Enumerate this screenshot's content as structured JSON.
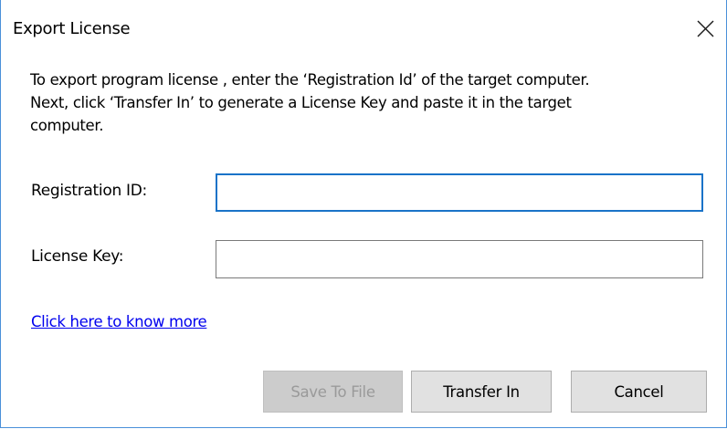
{
  "window": {
    "title": "Export License",
    "close_icon": "close-icon"
  },
  "instructions": {
    "line1": "To export program license , enter the ‘Registration Id’ of the target computer.",
    "line2": "Next, click ‘Transfer In’ to generate a License Key and paste it in the target",
    "line3": "computer."
  },
  "fields": {
    "registration_label": "Registration ID:",
    "registration_value": "",
    "license_label": "License Key:",
    "license_value": ""
  },
  "link": {
    "more_label": "Click here to know more"
  },
  "buttons": {
    "save_label": "Save To File",
    "save_enabled": false,
    "transfer_label": "Transfer In",
    "cancel_label": "Cancel"
  },
  "colors": {
    "focus_border": "#1a73c8",
    "window_border": "#4a90d9",
    "link": "#0000ee"
  }
}
